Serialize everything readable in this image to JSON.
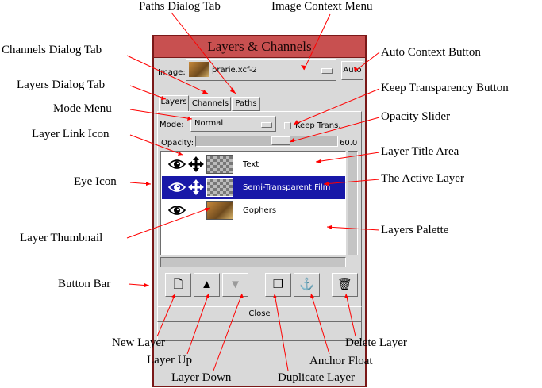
{
  "callouts": {
    "paths_dialog_tab": "Paths Dialog Tab",
    "image_context_menu": "Image Context Menu",
    "channels_dialog_tab": "Channels Dialog Tab",
    "auto_context_button": "Auto Context Button",
    "layers_dialog_tab": "Layers Dialog Tab",
    "keep_transparency_button": "Keep Transparency Button",
    "mode_menu": "Mode Menu",
    "opacity_slider": "Opacity Slider",
    "layer_link_icon": "Layer Link Icon",
    "layer_title_area": "Layer Title Area",
    "the_active_layer": "The Active Layer",
    "eye_icon": "Eye Icon",
    "layers_palette": "Layers Palette",
    "layer_thumbnail": "Layer Thumbnail",
    "button_bar": "Button Bar",
    "new_layer": "New Layer",
    "layer_up": "Layer Up",
    "layer_down": "Layer Down",
    "duplicate_layer": "Duplicate Layer",
    "anchor_float": "Anchor Float",
    "delete_layer": "Delete Layer"
  },
  "dialog": {
    "title": "Layers & Channels",
    "image_label": "Image:",
    "image_name": "prarie.xcf-2",
    "auto_button": "Auto",
    "tabs": [
      {
        "label": "Layers",
        "active": true
      },
      {
        "label": "Channels",
        "active": false
      },
      {
        "label": "Paths",
        "active": false
      }
    ],
    "mode_label": "Mode:",
    "mode_value": "Normal",
    "keep_trans_label": "Keep Trans.",
    "opacity_label": "Opacity:",
    "opacity_value": "60.0",
    "opacity_fraction": 0.6,
    "layers": [
      {
        "name": "Text",
        "visible": true,
        "linked": true,
        "active": false
      },
      {
        "name": "Semi-Transparent Film",
        "visible": true,
        "linked": true,
        "active": true
      },
      {
        "name": "Gophers",
        "visible": true,
        "linked": false,
        "active": false
      }
    ],
    "close_label": "Close"
  },
  "colors": {
    "titlebar": "#c85050",
    "active_layer": "#1818a8",
    "callout_line": "#ff0000"
  }
}
